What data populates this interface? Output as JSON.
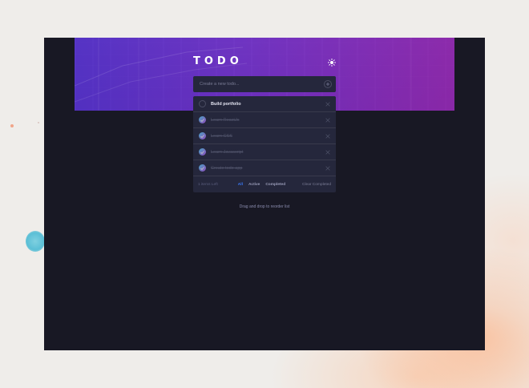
{
  "app": {
    "title": "TODO",
    "theme_icon": "sun-icon"
  },
  "new_todo": {
    "placeholder": "Create a new todo..."
  },
  "todos": [
    {
      "label": "Build portfolio",
      "completed": false
    },
    {
      "label": "Learn ReactJs",
      "completed": true
    },
    {
      "label": "Learn CSS",
      "completed": true
    },
    {
      "label": "Learn Javascript",
      "completed": true
    },
    {
      "label": "Create todo app",
      "completed": true
    }
  ],
  "footer": {
    "items_left": "1 items Left",
    "filters": [
      "All",
      "Active",
      "Completed"
    ],
    "selected_filter": "All",
    "clear_label": "Clear Completed"
  },
  "hint": "Drag and drop to reorder list",
  "colors": {
    "app_bg": "#181824",
    "card_bg": "#25273c",
    "accent": "#3a7cfd",
    "check_gradient_start": "#57ddff",
    "check_gradient_end": "#c058f3"
  }
}
